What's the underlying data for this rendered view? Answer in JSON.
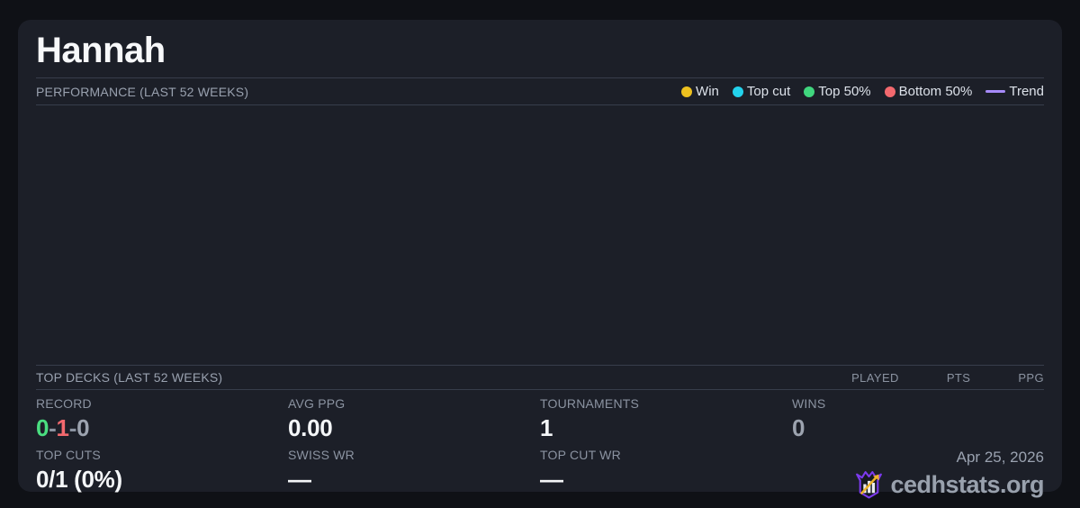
{
  "header": {
    "title": "Hannah"
  },
  "performance": {
    "heading": "PERFORMANCE (LAST 52 WEEKS)",
    "legend": [
      {
        "label": "Win",
        "color": "#eec11f"
      },
      {
        "label": "Top cut",
        "color": "#23d2ec"
      },
      {
        "label": "Top 50%",
        "color": "#40d67e"
      },
      {
        "label": "Bottom 50%",
        "color": "#f3696e"
      },
      {
        "label": "Trend",
        "color": "#a78bfa"
      }
    ]
  },
  "chart_data": {
    "type": "scatter",
    "title": "PERFORMANCE (LAST 52 WEEKS)",
    "points": [],
    "note": "chart plot area is rendered empty (no visible data points, axes or gridlines)"
  },
  "top_decks": {
    "heading": "TOP DECKS (LAST 52 WEEKS)",
    "columns": [
      "PLAYED",
      "PTS",
      "PPG"
    ],
    "rows": []
  },
  "stats": {
    "record": {
      "label": "RECORD",
      "wins": "0",
      "losses": "1",
      "draws": "0",
      "separator": "-",
      "wins_color": "#4ade80",
      "losses_color": "#f3696e",
      "draws_color": "#9ca3af"
    },
    "avg_ppg": {
      "label": "AVG PPG",
      "value": "0.00"
    },
    "tournaments": {
      "label": "TOURNAMENTS",
      "value": "1"
    },
    "wins": {
      "label": "WINS",
      "value": "0"
    },
    "top_cuts": {
      "label": "TOP CUTS",
      "value": "0/1 (0%)"
    },
    "swiss_wr": {
      "label": "SWISS WR",
      "value": "—"
    },
    "top_cut_wr": {
      "label": "TOP CUT WR",
      "value": "—"
    }
  },
  "footer": {
    "date": "Apr 25, 2026",
    "brand": "cedhstats.org",
    "brand_purple": "#7c3aed",
    "brand_gold": "#f0b429"
  }
}
